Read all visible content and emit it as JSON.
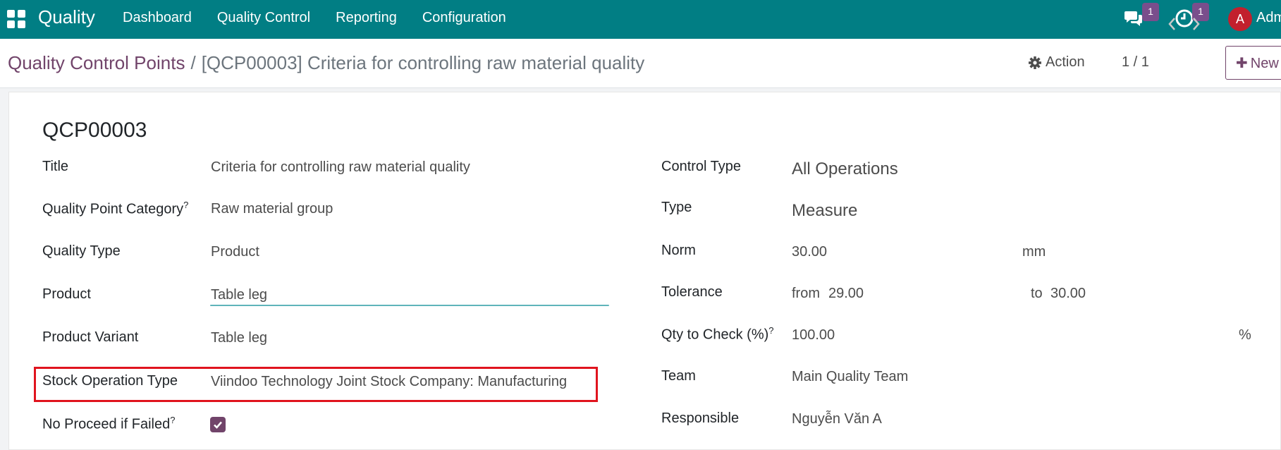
{
  "navbar": {
    "app_name": "Quality",
    "menu": [
      "Dashboard",
      "Quality Control",
      "Reporting",
      "Configuration"
    ],
    "messages_count": "1",
    "activities_count": "1",
    "avatar_letter": "A",
    "user_name": "Adm"
  },
  "control_panel": {
    "breadcrumb_parent": "Quality Control Points",
    "breadcrumb_separator": "/",
    "breadcrumb_current": "[QCP00003] Criteria for controlling raw material quality",
    "action_label": "Action",
    "pager": "1 / 1",
    "new_label": "New"
  },
  "form": {
    "record_name": "QCP00003",
    "left": {
      "title_label": "Title",
      "title_value": "Criteria for controlling raw material quality",
      "category_label": "Quality Point Category",
      "category_value": "Raw material group",
      "quality_type_label": "Quality Type",
      "quality_type_value": "Product",
      "product_label": "Product",
      "product_value": "Table leg",
      "variant_label": "Product Variant",
      "variant_value": "Table leg",
      "stock_op_label": "Stock Operation Type",
      "stock_op_value": "Viindoo Technology Joint Stock Company: Manufacturing",
      "no_proceed_label": "No Proceed if Failed",
      "no_proceed_checked": true
    },
    "right": {
      "control_type_label": "Control Type",
      "control_type_value": "All Operations",
      "type_label": "Type",
      "type_value": "Measure",
      "norm_label": "Norm",
      "norm_value": "30.00",
      "norm_unit": "mm",
      "tolerance_label": "Tolerance",
      "tolerance_from_label": "from",
      "tolerance_from_value": "29.00",
      "tolerance_to_label": "to",
      "tolerance_to_value": "30.00",
      "qty_check_label": "Qty to Check (%)",
      "qty_check_value": "100.00",
      "qty_check_unit": "%",
      "team_label": "Team",
      "team_value": "Main Quality Team",
      "responsible_label": "Responsible",
      "responsible_value": "Nguyễn Văn A"
    },
    "help_mark": "?"
  },
  "colors": {
    "navbar": "#017e84",
    "brand_purple": "#71446a",
    "badge": "#7a4e8c",
    "avatar": "#c2202d",
    "highlight": "#e0141e"
  }
}
